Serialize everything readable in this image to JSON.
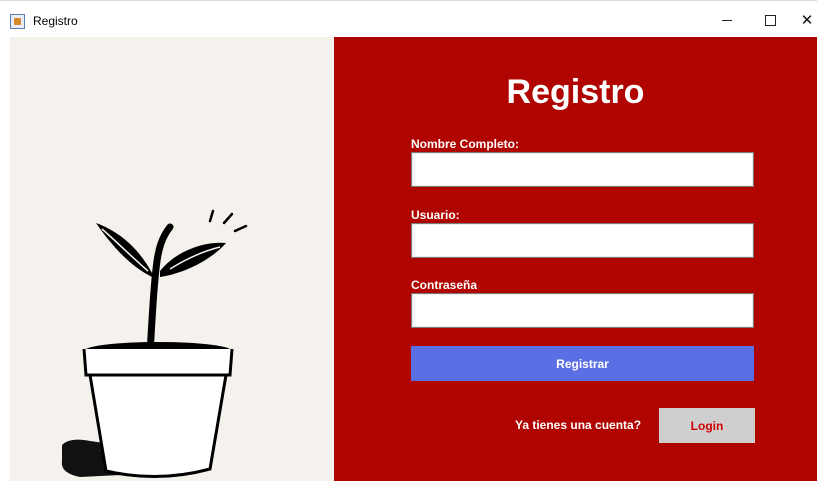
{
  "window": {
    "title": "Registro",
    "minimize_icon": "minimize-icon",
    "maximize_icon": "maximize-icon",
    "close_icon": "close-icon",
    "close_glyph": "✕"
  },
  "illustration": {
    "icon": "plant-pot-illustration"
  },
  "form": {
    "title": "Registro",
    "fields": [
      {
        "label": "Nombre Completo:",
        "value": ""
      },
      {
        "label": "Usuario:",
        "value": ""
      },
      {
        "label": "Contraseña",
        "value": ""
      }
    ],
    "submit_label": "Registrar",
    "account_prompt": "Ya tienes una cuenta?",
    "login_label": "Login"
  },
  "colors": {
    "panel_red": "#b00400",
    "left_background": "#f5f2ee",
    "submit_blue": "#5b6fe4",
    "login_gray": "#cfcfcf",
    "login_text_red": "#d00000"
  }
}
